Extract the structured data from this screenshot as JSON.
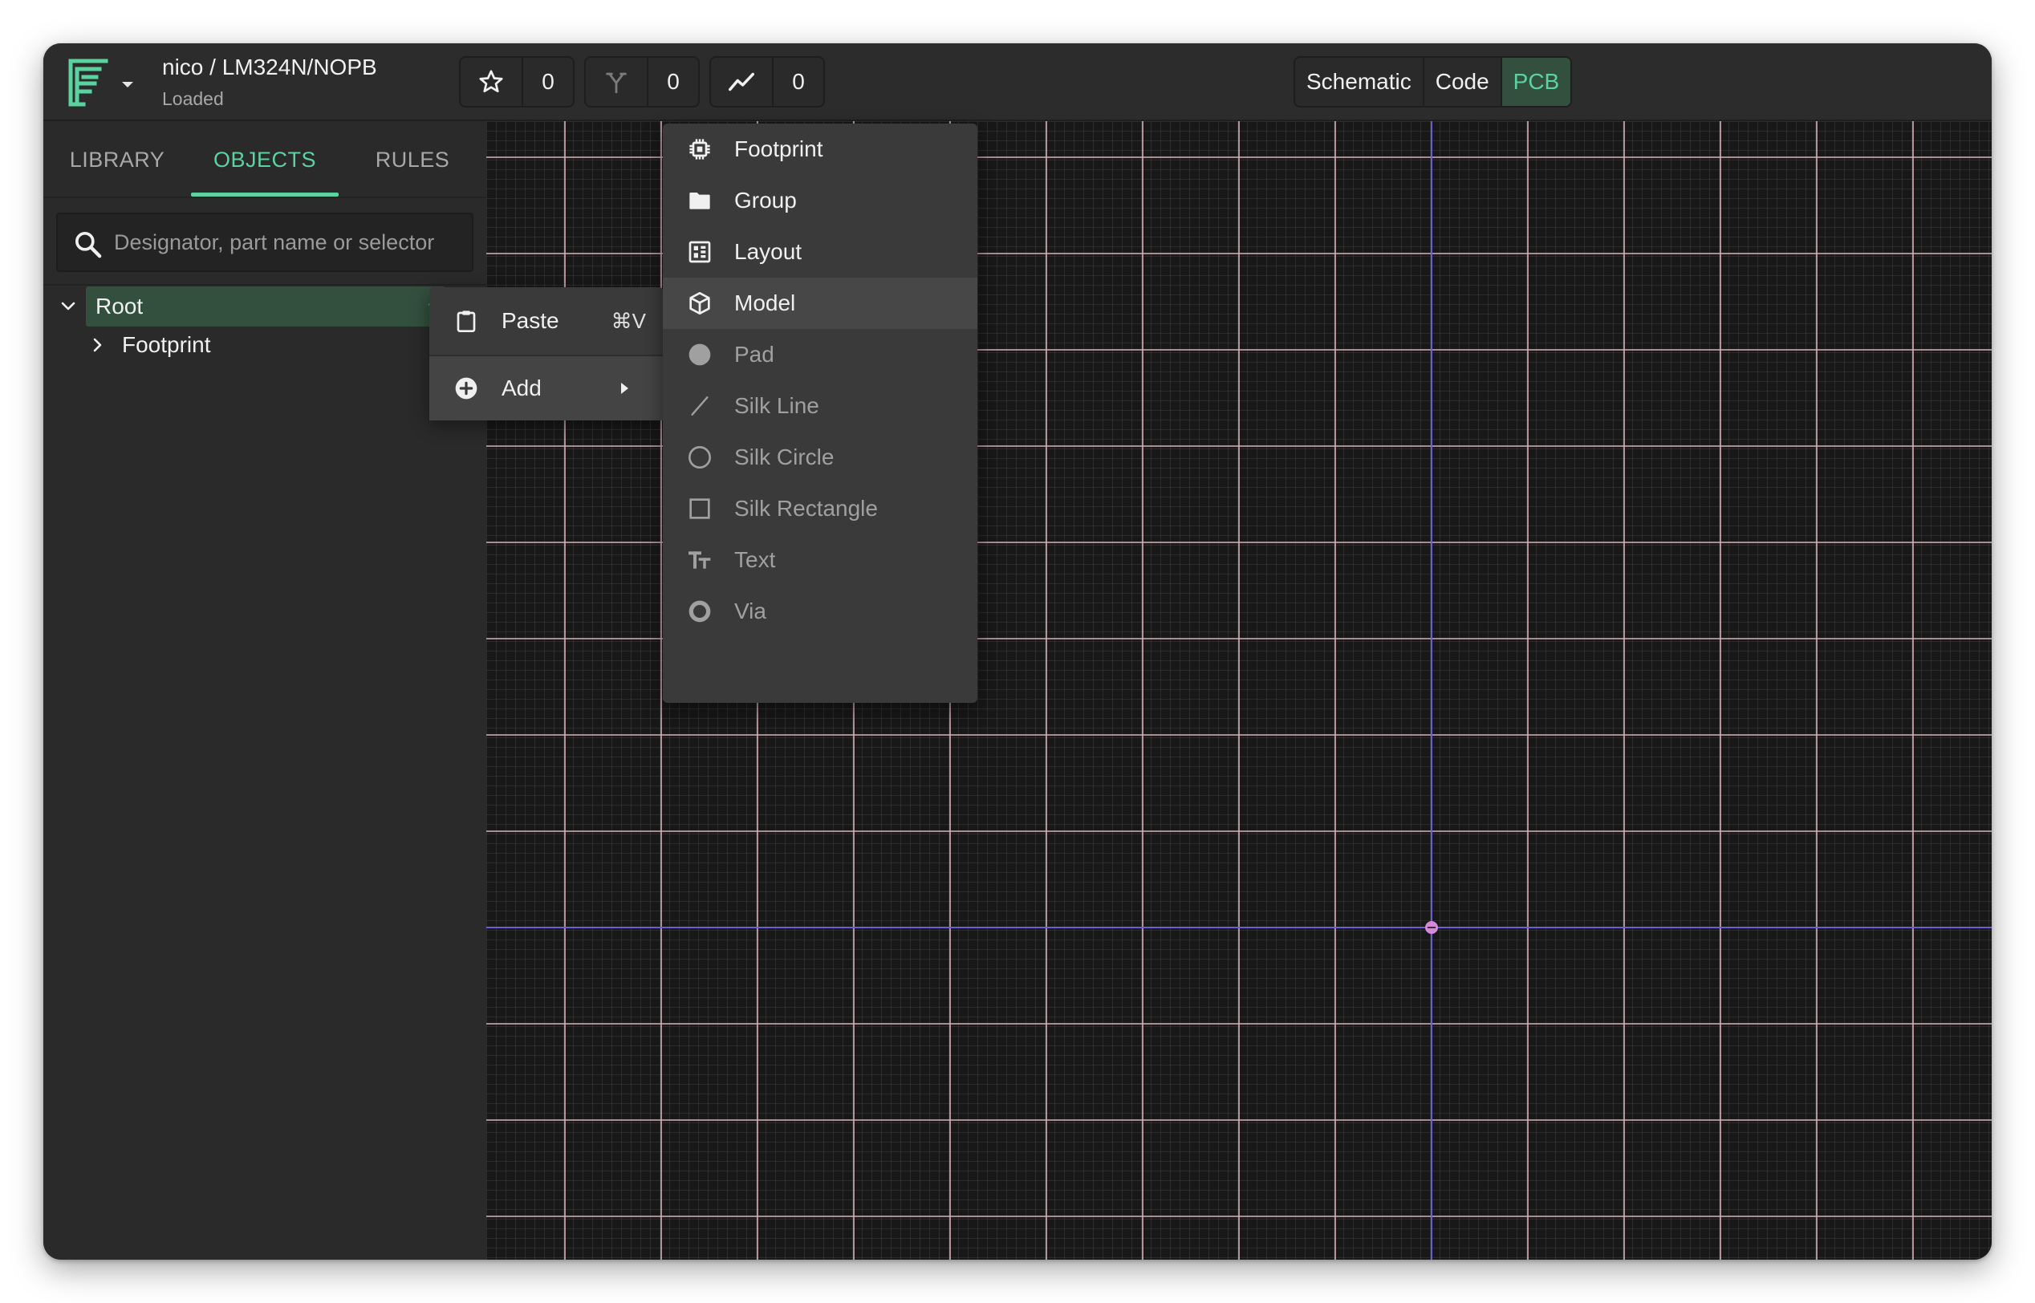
{
  "app": {
    "breadcrumb": "nico / LM324N/NOPB",
    "status": "Loaded",
    "accent_color": "#5bd3a1",
    "logo_icon": "fusion-logo-icon"
  },
  "toolbar": {
    "stars": {
      "icon": "star-icon",
      "count": "0"
    },
    "forks": {
      "icon": "fork-icon",
      "count": "0"
    },
    "activity": {
      "icon": "trend-icon",
      "count": "0"
    }
  },
  "view_toggle": {
    "items": [
      "Schematic",
      "Code",
      "PCB"
    ],
    "active": "PCB"
  },
  "sidebar": {
    "tabs": [
      "LIBRARY",
      "OBJECTS",
      "RULES"
    ],
    "active_tab": "OBJECTS",
    "search": {
      "placeholder": "Designator, part name or selector",
      "value": ""
    },
    "tree": {
      "root_label": "Root",
      "root_more": "••",
      "children": [
        "Footprint"
      ]
    }
  },
  "context_menu": {
    "paste": {
      "label": "Paste",
      "shortcut": "⌘V",
      "icon": "clipboard-icon"
    },
    "add": {
      "label": "Add",
      "icon": "plus-circle-icon"
    }
  },
  "add_submenu": {
    "items": [
      {
        "label": "Footprint",
        "icon": "chip-icon",
        "enabled": true
      },
      {
        "label": "Group",
        "icon": "folder-icon",
        "enabled": true
      },
      {
        "label": "Layout",
        "icon": "layout-icon",
        "enabled": true
      },
      {
        "label": "Model",
        "icon": "cube-icon",
        "enabled": true,
        "highlighted": true
      },
      {
        "label": "Pad",
        "icon": "pad-icon",
        "enabled": false
      },
      {
        "label": "Silk Line",
        "icon": "line-icon",
        "enabled": false
      },
      {
        "label": "Silk Circle",
        "icon": "circle-icon",
        "enabled": false
      },
      {
        "label": "Silk Rectangle",
        "icon": "rectangle-icon",
        "enabled": false
      },
      {
        "label": "Text",
        "icon": "text-icon",
        "enabled": false
      },
      {
        "label": "Via",
        "icon": "via-icon",
        "enabled": false
      }
    ]
  },
  "canvas": {
    "grid_color": "#d8b2b8",
    "axis_color": "#6a5fd6",
    "origin_color": "#d58ad8"
  }
}
